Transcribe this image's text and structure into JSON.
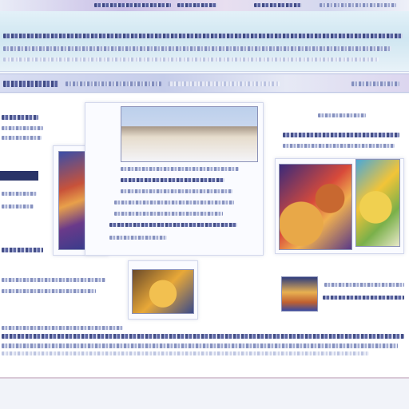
{
  "colors": {
    "header_bg": "#cfe6f1",
    "nav_bg": "#c6cdea",
    "content_bg": "#ffffff",
    "accent_dark": "#2a3468"
  },
  "header": {},
  "nav": {},
  "main": {},
  "footer": {}
}
